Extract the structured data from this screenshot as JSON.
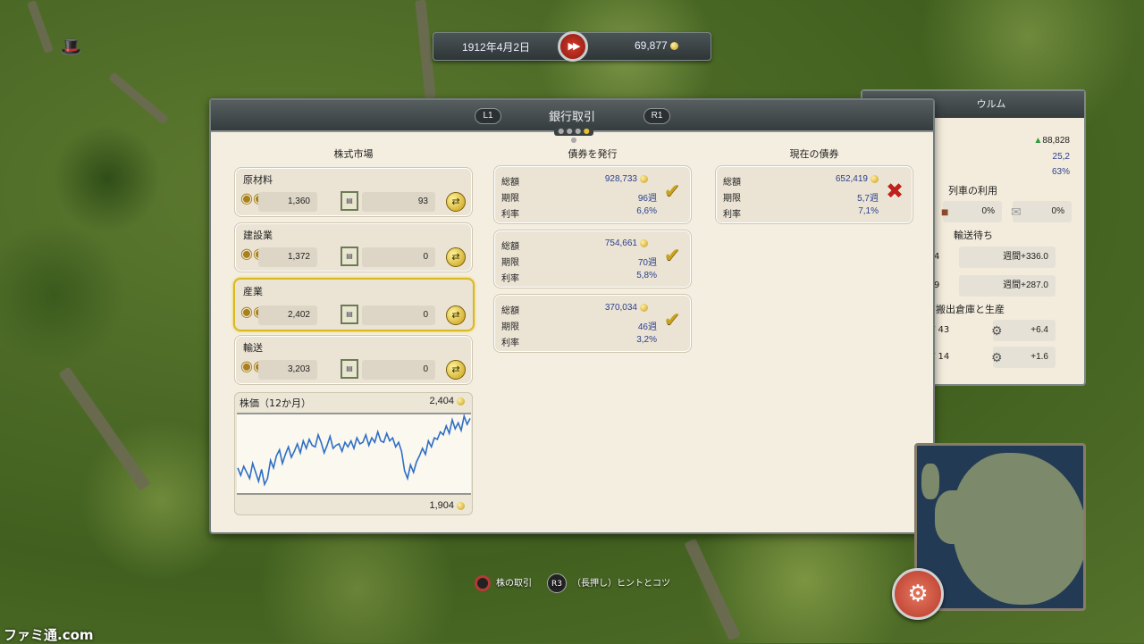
{
  "topbar": {
    "date": "1912年4月2日",
    "money": "69,877",
    "speed_icon": "fast-forward-icon"
  },
  "side_panel": {
    "title": "ウルム",
    "value1": "88,828",
    "value2": "25,2",
    "value3": "63%",
    "train_usage_label": "列車の利用",
    "cargo_pct": "0%",
    "mail_pct": "0%",
    "waiting_label": "輸送待ち",
    "week1": "週間+336.0",
    "week2": "週間+287.0",
    "row1_partial": "4",
    "row2_partial": "9",
    "warehouse_label": "搬出倉庫と生産",
    "prod1_partial": "/ 43",
    "prod2_partial": "/ 14",
    "prod1": "+6.4",
    "prod2": "+1.6"
  },
  "main": {
    "title": "銀行取引",
    "l1": "L1",
    "r1": "R1",
    "stock_header": "株式市場",
    "issue_header": "債券を発行",
    "current_header": "現在の債券",
    "stocks": [
      {
        "name": "原材料",
        "price": "1,360",
        "shares": "93"
      },
      {
        "name": "建設業",
        "price": "1,372",
        "shares": "0"
      },
      {
        "name": "産業",
        "price": "2,402",
        "shares": "0"
      },
      {
        "name": "輸送",
        "price": "3,203",
        "shares": "0"
      }
    ],
    "labels": {
      "total": "総額",
      "term": "期限",
      "rate": "利率"
    },
    "issue_bonds": [
      {
        "total": "928,733",
        "term": "96週",
        "rate": "6,6%"
      },
      {
        "total": "754,661",
        "term": "70週",
        "rate": "5,8%"
      },
      {
        "total": "370,034",
        "term": "46週",
        "rate": "3,2%"
      }
    ],
    "current_bonds": [
      {
        "total": "652,419",
        "term": "5,7週",
        "rate": "7,1%"
      }
    ]
  },
  "chart_data": {
    "type": "line",
    "title": "株価（12か月）",
    "max_label": "2,404",
    "min_label": "1,904",
    "ylim": [
      1904,
      2404
    ],
    "values": [
      2060,
      2010,
      2070,
      2030,
      1990,
      2090,
      2030,
      1970,
      2050,
      1950,
      1990,
      2110,
      2060,
      2140,
      2180,
      2090,
      2150,
      2200,
      2130,
      2170,
      2220,
      2160,
      2240,
      2190,
      2250,
      2210,
      2200,
      2280,
      2230,
      2160,
      2210,
      2270,
      2190,
      2210,
      2220,
      2170,
      2230,
      2200,
      2240,
      2190,
      2260,
      2220,
      2230,
      2280,
      2210,
      2260,
      2230,
      2300,
      2240,
      2230,
      2290,
      2240,
      2260,
      2200,
      2230,
      2170,
      2040,
      1990,
      2080,
      2030,
      2100,
      2140,
      2190,
      2150,
      2240,
      2200,
      2260,
      2250,
      2300,
      2280,
      2340,
      2290,
      2380,
      2320,
      2360,
      2310,
      2404,
      2350,
      2390
    ]
  },
  "footer": {
    "trade_label": "株の取引",
    "r3_label": "R3",
    "hint_label": "（長押し）ヒントとコツ"
  },
  "watermark": "ファミ通.com"
}
